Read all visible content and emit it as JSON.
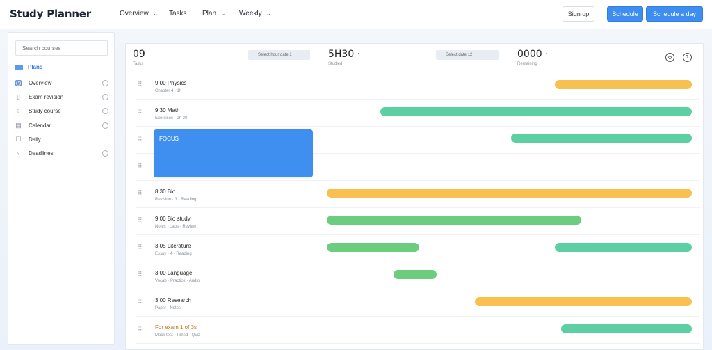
{
  "app": {
    "title": "Study Planner"
  },
  "nav": [
    {
      "label": "Overview"
    },
    {
      "label": "Tasks"
    },
    {
      "label": "Plan"
    },
    {
      "label": "Weekly"
    }
  ],
  "header_buttons": {
    "sign_in": "Sign up",
    "primary": "Schedule",
    "secondary": "Schedule a day"
  },
  "sidebar": {
    "search_placeholder": "Search courses",
    "heading": "Plans",
    "items": [
      {
        "label": "Overview",
        "icon": "clock-icon"
      },
      {
        "label": "Exam revision",
        "icon": "bookmark-icon"
      },
      {
        "label": "Study course",
        "icon": "circle-icon"
      },
      {
        "label": "Calendar",
        "icon": "calendar-icon"
      },
      {
        "label": "Daily",
        "icon": "checkbox-icon"
      },
      {
        "label": "Deadlines",
        "icon": "pin-icon"
      }
    ]
  },
  "stats": [
    {
      "value": "09",
      "sub": "Tasks",
      "chip": "Select hour date 1"
    },
    {
      "value": "5H30 ·",
      "sub": "Studied",
      "chip": "Select date 12"
    },
    {
      "value": "0000 ·",
      "sub": "Remaining"
    }
  ],
  "rows": [
    {
      "title": "9:00 Physics",
      "meta": "Chapter 4 · 1h"
    },
    {
      "title": "9:30 Math",
      "meta": "Exercises · 2h 30"
    },
    {
      "title": "",
      "meta": ""
    },
    {
      "title": "",
      "meta": ""
    },
    {
      "title": "8:30 Bio",
      "meta": "Revision · 3 · Reading"
    },
    {
      "title": "9:00 Bio study",
      "meta": "Notes · Labs · Review"
    },
    {
      "title": "3:05 Literature",
      "meta": "Essay · 4 · Reading"
    },
    {
      "title": "3:00 Language",
      "meta": "Vocab · Practice · Audio"
    },
    {
      "title": "3:00 Research",
      "meta": "Paper · Notes"
    },
    {
      "title": "For exam 1 of 3s",
      "meta": "Mock test · Timed · Quiz"
    }
  ],
  "block": {
    "title": "FOCUS"
  },
  "colors": {
    "primary": "#3d8ef0",
    "orange": "#f7c04f",
    "teal": "#5cd0a3",
    "green": "#6ccd7f"
  }
}
